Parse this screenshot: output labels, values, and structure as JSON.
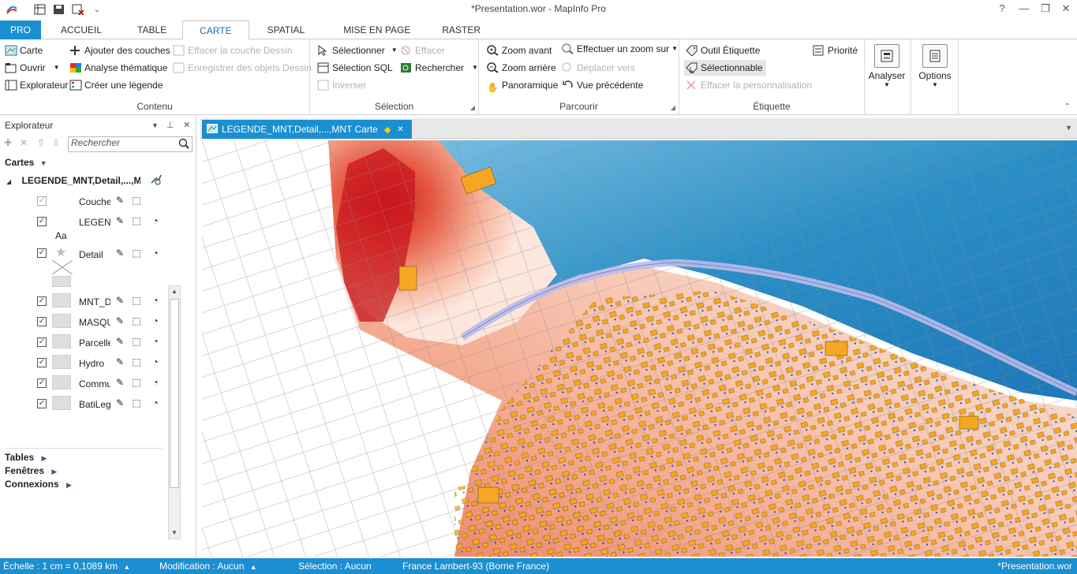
{
  "app": {
    "title": "*Presentation.wor - MapInfo Pro"
  },
  "tabs": [
    "PRO",
    "ACCUEIL",
    "TABLE",
    "CARTE",
    "SPATIAL",
    "MISE EN PAGE",
    "RASTER"
  ],
  "ribbon": {
    "contenu": {
      "title": "Contenu",
      "carte": "Carte",
      "ouvrir": "Ouvrir",
      "explorateur": "Explorateur",
      "ajouter": "Ajouter des couches",
      "analyse": "Analyse thématique",
      "legende": "Créer une légende",
      "effacer_couche": "Effacer la couche Dessin",
      "enregistrer": "Enregistrer des objets Dessin"
    },
    "selection": {
      "title": "Sélection",
      "selectionner": "Sélectionner",
      "sql": "Sélection SQL",
      "inverser": "Inverser",
      "effacer": "Effacer",
      "rechercher": "Rechercher"
    },
    "parcourir": {
      "title": "Parcourir",
      "zoom_avant": "Zoom avant",
      "zoom_arriere": "Zoom arrière",
      "panoramique": "Panoramique",
      "zoom_sur": "Effectuer un zoom sur",
      "deplacer": "Déplacer vers",
      "vue_prec": "Vue précédente"
    },
    "etiquette": {
      "title": "Étiquette",
      "outil": "Outil Étiquette",
      "selectionnable": "Sélectionnable",
      "effacer_perso": "Effacer la personnalisation",
      "priorite": "Priorité"
    },
    "analyser": "Analyser",
    "options": "Options"
  },
  "explorer": {
    "title": "Explorateur",
    "search_placeholder": "Rechercher",
    "cartes": "Cartes",
    "map_name": "LEGENDE_MNT,Detail,...,M",
    "layers": [
      "Couche",
      "LEGENDE",
      "Detail",
      "MNT_D",
      "MASQU",
      "Parcelle",
      "Hydro",
      "Commu",
      "BatiLeg"
    ],
    "aa_label": "Aa",
    "tables": "Tables",
    "fenetres": "Fenêtres",
    "connexions": "Connexions"
  },
  "map": {
    "tab_title": "LEGENDE_MNT,Detail,...,MNT Carte"
  },
  "status": {
    "echelle": "Échelle : 1 cm = 0,1089 km",
    "modification": "Modification : Aucun",
    "selection": "Sélection : Aucun",
    "projection": "France Lambert-93 (Borne France)",
    "workspace": "*Presentation.wor"
  },
  "colors": {
    "accent": "#1a8fd1",
    "water": "#2b8fc6",
    "relief_red": "#d7301f",
    "building": "#f5a623"
  }
}
